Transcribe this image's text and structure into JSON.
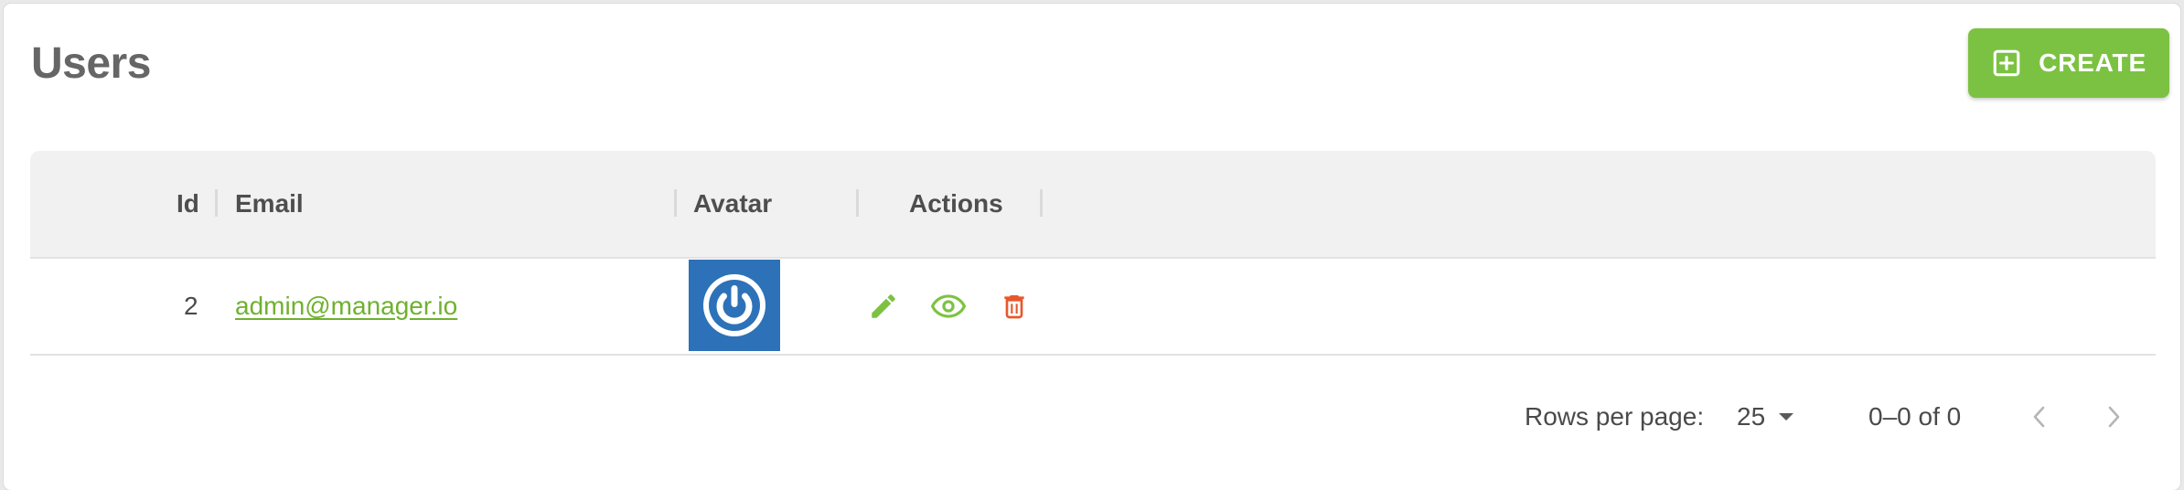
{
  "header": {
    "title": "Users",
    "create_label": "CREATE"
  },
  "table": {
    "columns": [
      "Id",
      "Email",
      "Avatar",
      "Actions"
    ],
    "rows": [
      {
        "id": "2",
        "email": "admin@manager.io",
        "avatar_icon": "power-icon"
      }
    ],
    "action_icons": [
      "edit-icon",
      "view-icon",
      "delete-icon"
    ]
  },
  "pagination": {
    "rows_per_page_label": "Rows per page:",
    "rows_per_page_value": "25",
    "range_text": "0–0 of 0"
  },
  "colors": {
    "accent": "#7cc242",
    "link": "#6fb12f",
    "delete": "#e8572b",
    "avatar_bg": "#2d72b8"
  }
}
